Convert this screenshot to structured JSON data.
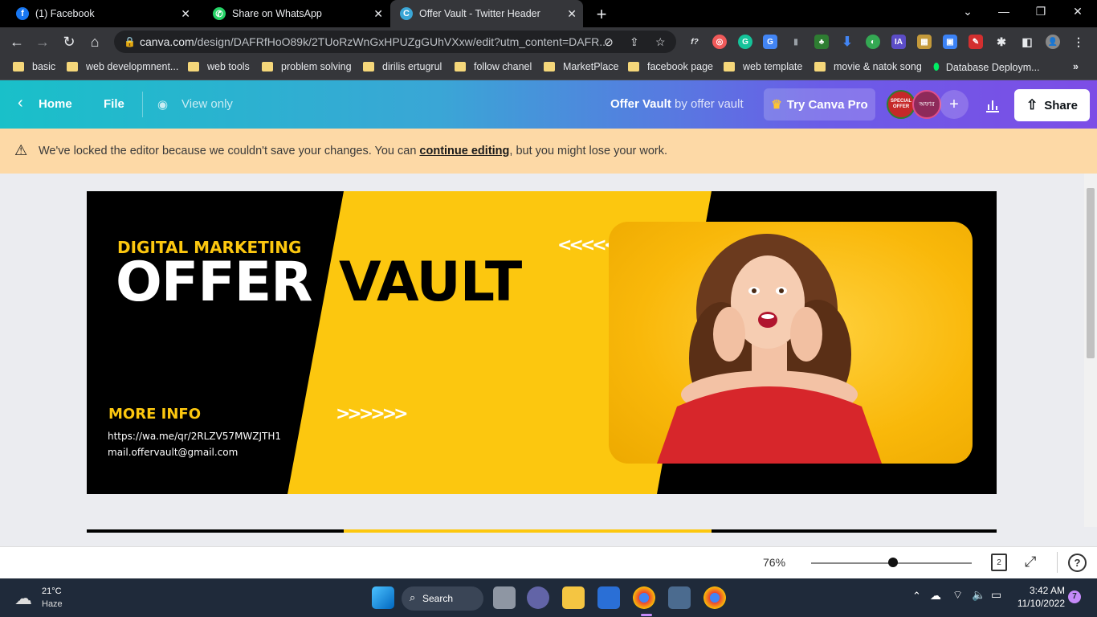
{
  "browser": {
    "tabs": [
      {
        "title": "(1) Facebook"
      },
      {
        "title": "Share on WhatsApp"
      },
      {
        "title": "Offer Vault - Twitter Header"
      }
    ],
    "url_domain": "canva.com",
    "url_path": "/design/DAFRfHoO89k/2TUoRzWnGxHPUZgGUhVXxw/edit?utm_content=DAFR...",
    "bookmarks": [
      "basic",
      "web developmnent...",
      "web tools",
      "problem solving",
      "dirilis ertugrul",
      "follow chanel",
      "MarketPlace",
      "facebook page",
      "web template",
      "movie & natok song",
      "Database Deploym..."
    ]
  },
  "canva": {
    "home": "Home",
    "file": "File",
    "view_only": "View only",
    "doc_title": "Offer Vault",
    "doc_by": "by offer vault",
    "try_pro": "Try Canva Pro",
    "share": "Share",
    "badge1": "SPECIAL OFFER",
    "badge2": "অফার"
  },
  "warning": {
    "prefix": "We've locked the editor because we couldn't save your changes. You can ",
    "link": "continue editing",
    "suffix": ", but you might lose your work."
  },
  "design": {
    "kicker": "DIGITAL MARKETING",
    "title_left": "OFFER",
    "title_right": "VAULT",
    "arrows_left": "<<<<<<",
    "arrows_right": ">>>>>>",
    "more_info": "MORE INFO",
    "link": "https://wa.me/qr/2RLZV57MWZJTH1",
    "email": "mail.offervault@gmail.com"
  },
  "zoom": "76%",
  "page_count": "2",
  "taskbar": {
    "temp": "21°C",
    "weather": "Haze",
    "search": "Search",
    "time": "3:42 AM",
    "date": "11/10/2022",
    "notifications": "7"
  },
  "colors": {
    "accent_yellow": "#fcc70f",
    "canva_teal": "#19c0c9",
    "canva_purple": "#7d4de6"
  }
}
